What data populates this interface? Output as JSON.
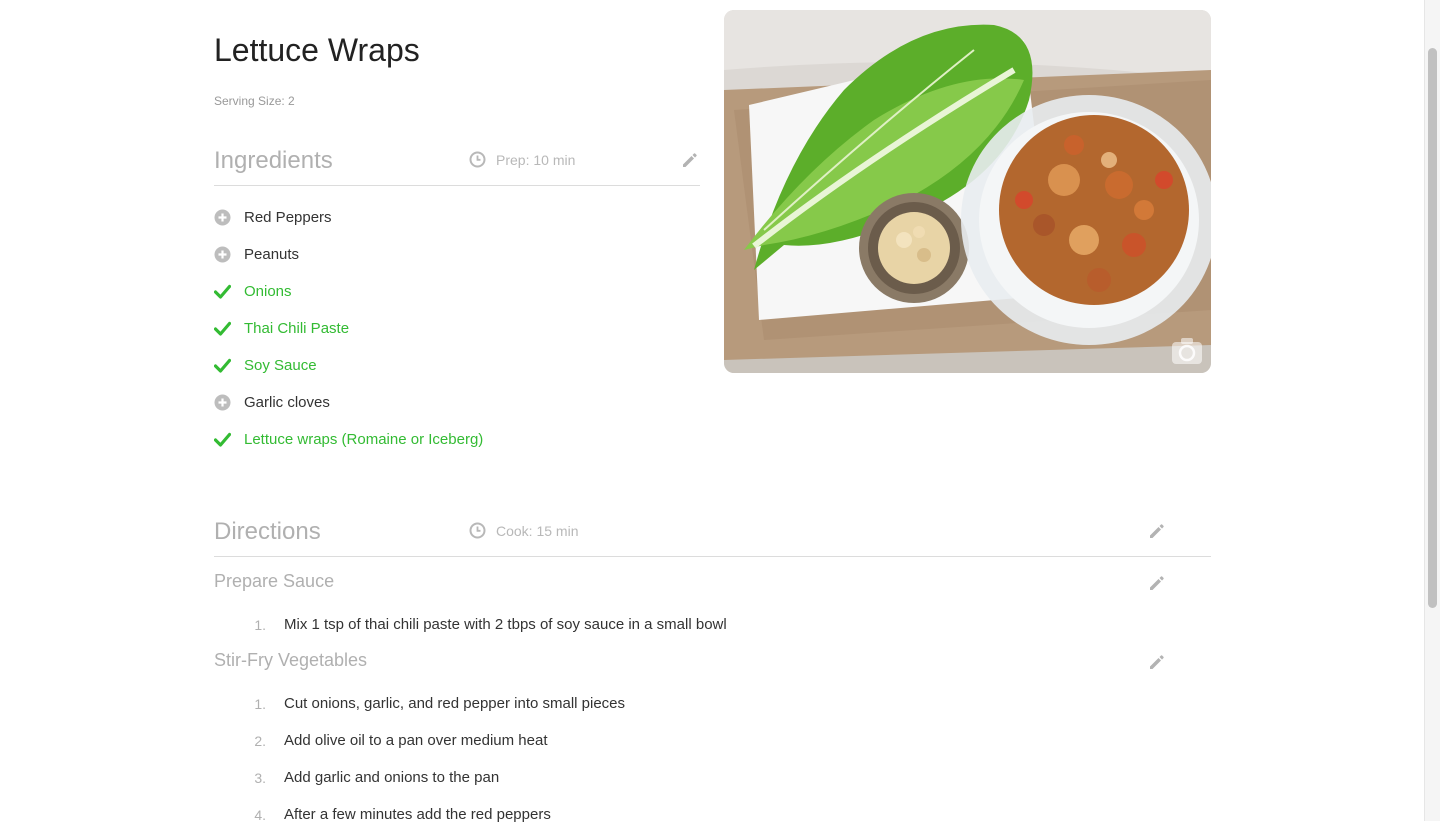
{
  "recipe": {
    "title": "Lettuce Wraps",
    "serving_size": "Serving Size: 2"
  },
  "ingredients": {
    "heading": "Ingredients",
    "prep_time": "Prep: 10 min",
    "edit_icon": "pencil-icon",
    "items": [
      {
        "label": "Red Peppers",
        "checked": false
      },
      {
        "label": "Peanuts",
        "checked": false
      },
      {
        "label": "Onions",
        "checked": true
      },
      {
        "label": "Thai Chili Paste",
        "checked": true
      },
      {
        "label": "Soy Sauce",
        "checked": true
      },
      {
        "label": "Garlic cloves",
        "checked": false
      },
      {
        "label": "Lettuce wraps (Romaine or Iceberg)",
        "checked": true
      }
    ]
  },
  "photo": {
    "camera_icon": "camera-icon"
  },
  "directions": {
    "heading": "Directions",
    "cook_time": "Cook: 15 min",
    "sections": [
      {
        "title": "Prepare Sauce",
        "steps": [
          {
            "num": "1.",
            "text": "Mix 1 tsp of thai chili paste with 2 tbps of soy sauce in a small bowl"
          }
        ]
      },
      {
        "title": "Stir-Fry Vegetables",
        "steps": [
          {
            "num": "1.",
            "text": "Cut onions, garlic, and red pepper into small pieces"
          },
          {
            "num": "2.",
            "text": "Add olive oil to a pan over medium heat"
          },
          {
            "num": "3.",
            "text": "Add garlic and onions to the pan"
          },
          {
            "num": "4.",
            "text": "After a few minutes add the red peppers"
          }
        ]
      }
    ]
  },
  "colors": {
    "checked_green": "#33bb33",
    "muted_gray": "#b0b0b0"
  }
}
